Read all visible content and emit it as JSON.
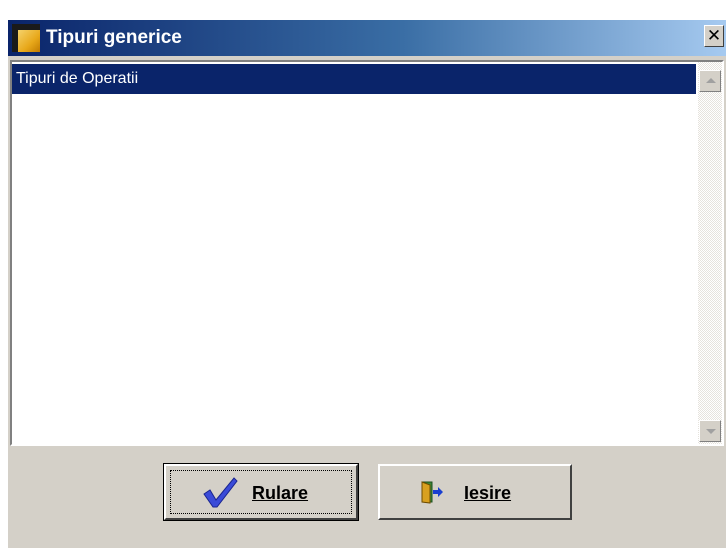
{
  "window": {
    "title": "Tipuri generice",
    "close_label": "✕"
  },
  "list": {
    "items": [
      {
        "label": "Tipuri de Operatii",
        "selected": true
      }
    ]
  },
  "buttons": {
    "run_label": "Rulare",
    "exit_label": "Iesire"
  },
  "colors": {
    "selection": "#0a246a",
    "titlebar_start": "#0a246a",
    "titlebar_end": "#a6caf0",
    "face": "#d4d0c8"
  }
}
